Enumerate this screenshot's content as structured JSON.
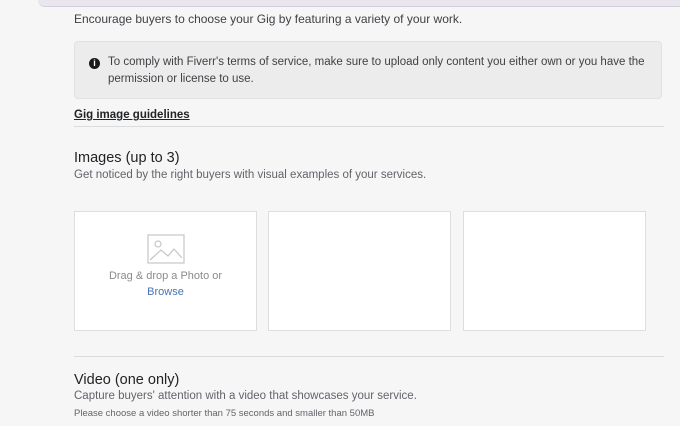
{
  "intro": "Encourage buyers to choose your Gig by featuring a variety of your work.",
  "notice": {
    "icon": "info-icon",
    "text": "To comply with Fiverr's terms of service, make sure to upload only content you either own or you have the permission or license to use."
  },
  "guidelines_link": "Gig image guidelines",
  "images": {
    "title": "Images (up to 3)",
    "subtitle": "Get noticed by the right buyers with visual examples of your services.",
    "upload_prompt": "Drag & drop a Photo or",
    "browse": "Browse",
    "upload_icon": "photo-icon"
  },
  "video": {
    "title": "Video (one only)",
    "subtitle": "Capture buyers' attention with a video that showcases your service.",
    "note": "Please choose a video shorter than 75 seconds and smaller than 50MB"
  }
}
